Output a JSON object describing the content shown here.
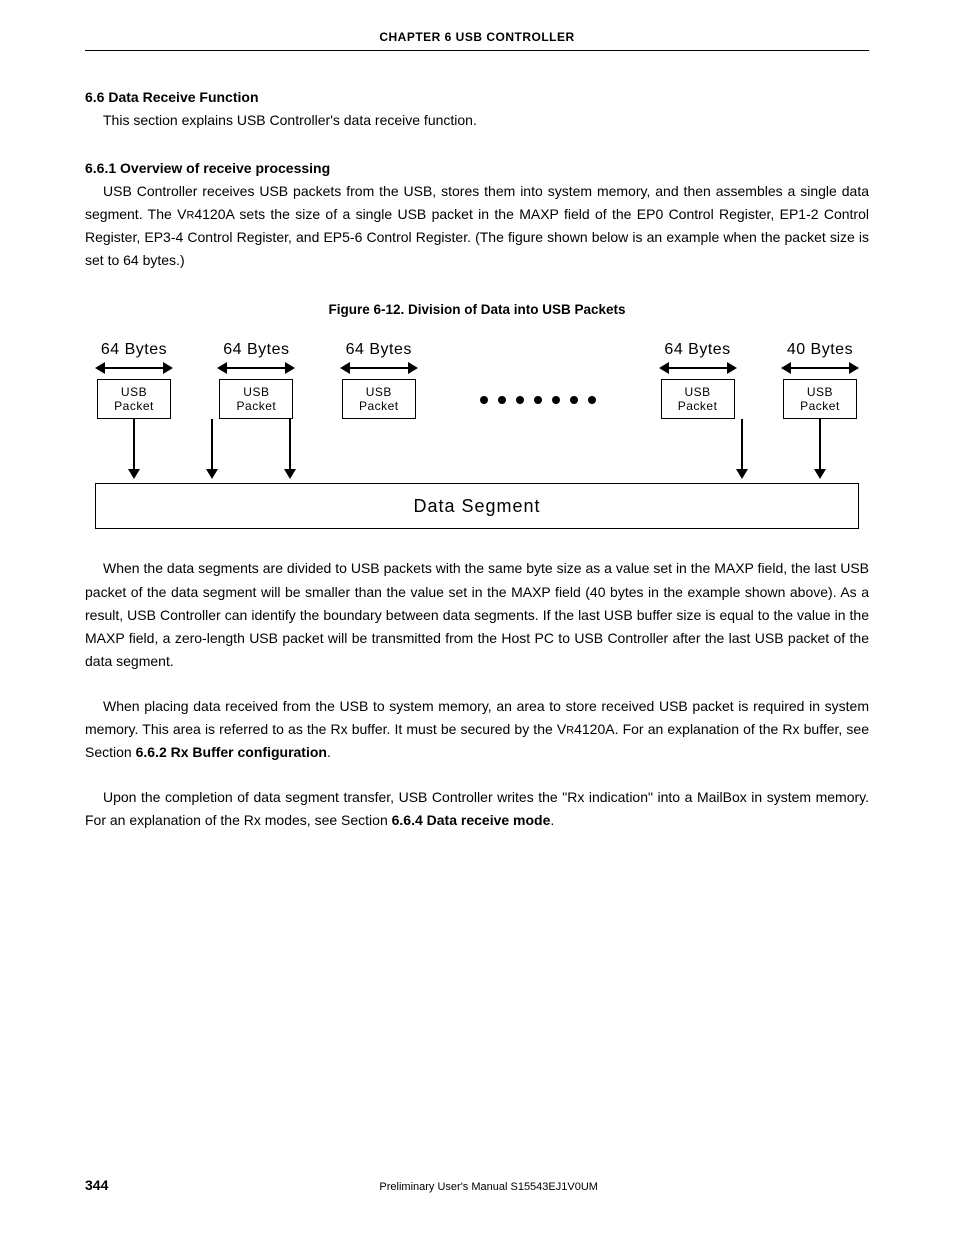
{
  "header": {
    "running": "CHAPTER  6   USB  CONTROLLER"
  },
  "section": {
    "heading": "6.6  Data Receive Function",
    "intro": "This section explains USB Controller's data receive function."
  },
  "subsection": {
    "heading": "6.6.1  Overview of receive processing",
    "para1_a": "USB Controller receives USB packets from the USB, stores them into system memory, and then assembles a single data segment. The V",
    "para1_r": "R",
    "para1_b": "4120A sets the size of a single USB packet in the MAXP field of the EP0 Control Register, EP1-2 Control Register, EP3-4 Control Register, and EP5-6 Control Register. (The figure shown below is an example when the packet size is set to 64 bytes.)"
  },
  "figure": {
    "caption": "Figure 6-12.  Division of Data into USB Packets",
    "packets": [
      {
        "bytes": "64 Bytes",
        "line1": "USB",
        "line2": "Packet"
      },
      {
        "bytes": "64 Bytes",
        "line1": "USB",
        "line2": "Packet"
      },
      {
        "bytes": "64 Bytes",
        "line1": "USB",
        "line2": "Packet"
      },
      {
        "bytes": "64 Bytes",
        "line1": "USB",
        "line2": "Packet"
      },
      {
        "bytes": "40 Bytes",
        "line1": "USB",
        "line2": "Packet"
      }
    ],
    "segment": "Data Segment"
  },
  "body": {
    "p2": "When the data segments are divided to USB packets with the same byte size as a value set in the MAXP field, the last USB packet of the data segment will be smaller than the value set in the MAXP field (40 bytes in the example shown above). As a result, USB Controller can identify the boundary between data segments. If the last USB buffer size is equal to the value in the MAXP field, a zero-length USB packet will be transmitted from the Host PC to USB Controller after the last USB packet of the data segment.",
    "p3_a": "When placing data received from the USB to system memory, an area to store received USB packet is required in system memory. This area is referred to as the Rx buffer. It must be secured by the V",
    "p3_r": "R",
    "p3_b": "4120A. For an explanation of the Rx buffer, see Section ",
    "p3_ref": "6.6.2  Rx Buffer configuration",
    "p3_c": ".",
    "p4_a": "Upon the completion of data segment transfer, USB Controller writes the \"Rx indication\" into a MailBox in system memory. For an explanation of the Rx modes, see Section ",
    "p4_ref": "6.6.4  Data receive mode",
    "p4_b": "."
  },
  "footer": {
    "page": "344",
    "center": "Preliminary User's Manual   S15543EJ1V0UM"
  }
}
